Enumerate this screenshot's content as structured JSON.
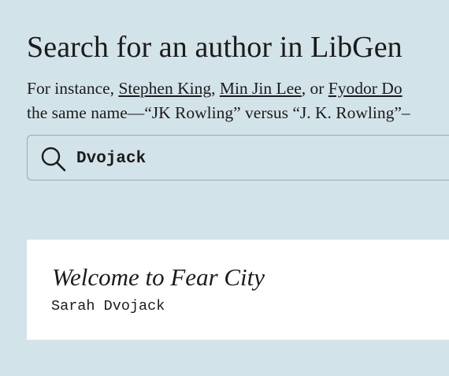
{
  "header": {
    "title": "Search for an author in LibGen"
  },
  "intro": {
    "prefix": "For instance, ",
    "example_1": "Stephen King",
    "sep_1": ", ",
    "example_2": "Min Jin Lee",
    "sep_2": ", or ",
    "example_3": "Fyodor Do",
    "line_2": "the same name—“JK Rowling” versus “J. K. Rowling”–"
  },
  "search": {
    "value": "Dvojack",
    "icon": "search-icon"
  },
  "results": [
    {
      "title": "Welcome to Fear City",
      "author": "Sarah Dvojack"
    }
  ],
  "colors": {
    "background": "#d3e3ea",
    "card": "#ffffff",
    "text": "#1b1b1b",
    "border": "#9fa8ad"
  }
}
